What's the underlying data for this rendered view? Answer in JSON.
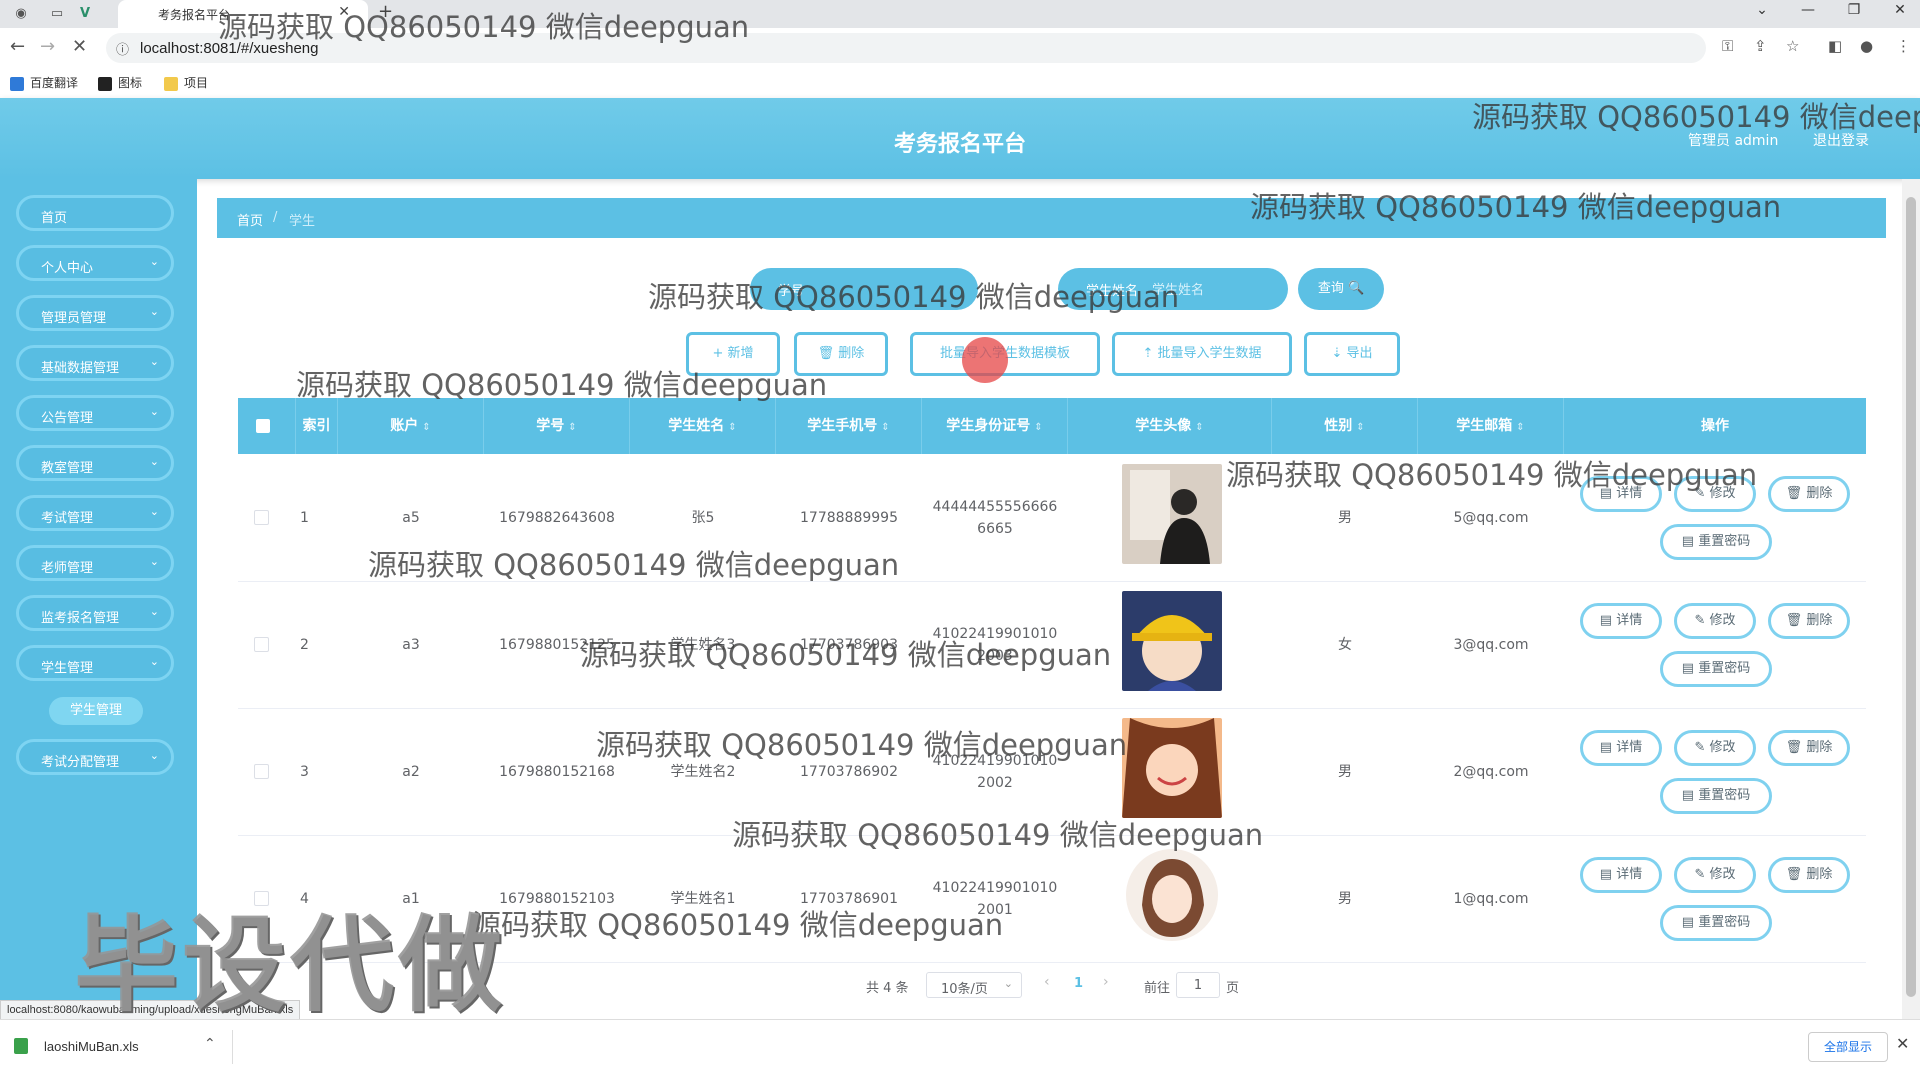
{
  "browser": {
    "tab_title": "考务报名平台",
    "url": "localhost:8081/#/xuesheng",
    "bookmarks": [
      "百度翻译",
      "图标",
      "项目"
    ]
  },
  "app": {
    "title": "考务报名平台",
    "user_label": "管理员 admin",
    "logout": "退出登录"
  },
  "sidebar": {
    "items": [
      "首页",
      "个人中心",
      "管理员管理",
      "基础数据管理",
      "公告管理",
      "教室管理",
      "考试管理",
      "老师管理",
      "监考报名管理",
      "学生管理",
      "考试分配管理"
    ],
    "active_sub": "学生管理"
  },
  "breadcrumb": {
    "home": "首页",
    "sep": "/",
    "current": "学生"
  },
  "search": {
    "field1_label": "学号",
    "field2_label": "学生姓名",
    "field2_placeholder": "学生姓名",
    "query_btn": "查询 🔍"
  },
  "toolbar": {
    "add": "+ 新增",
    "delete": "🗑 删除",
    "template": "批量导入学生数据模板",
    "import": "⇡ 批量导入学生数据",
    "export": "⇣ 导出"
  },
  "table": {
    "headers": [
      "索引",
      "账户",
      "学号",
      "学生姓名",
      "学生手机号",
      "学生身份证号",
      "学生头像",
      "性别",
      "学生邮箱",
      "操作"
    ],
    "rows": [
      {
        "index": "1",
        "account": "a5",
        "student_no": "1679882643608",
        "name": "张5",
        "phone": "17788889995",
        "id_card": "444444555566666665",
        "gender": "男",
        "email": "5@qq.com"
      },
      {
        "index": "2",
        "account": "a3",
        "student_no": "1679880152125",
        "name": "学生姓名3",
        "phone": "17703786903",
        "id_card": "410224199010102003",
        "gender": "女",
        "email": "3@qq.com"
      },
      {
        "index": "3",
        "account": "a2",
        "student_no": "1679880152168",
        "name": "学生姓名2",
        "phone": "17703786902",
        "id_card": "410224199010102002",
        "gender": "男",
        "email": "2@qq.com"
      },
      {
        "index": "4",
        "account": "a1",
        "student_no": "1679880152103",
        "name": "学生姓名1",
        "phone": "17703786901",
        "id_card": "410224199010102001",
        "gender": "男",
        "email": "1@qq.com"
      }
    ],
    "actions": {
      "detail": "详情",
      "edit": "修改",
      "remove": "删除",
      "reset_pwd": "重置密码"
    }
  },
  "pagination": {
    "total": "共 4 条",
    "page_size": "10条/页",
    "current_page": "1",
    "goto": "前往",
    "goto_value": "1",
    "page_unit": "页"
  },
  "status_url": "localhost:8080/kaowubaoming/upload/xueshengMuBan.xls",
  "download": {
    "file": "laoshiMuBan.xls",
    "show_all": "全部显示"
  },
  "watermarks": {
    "text": "源码获取 QQ86050149 微信deepguan",
    "text_cut": "源码获取 QQ86050149 微信deep",
    "big": "毕设代做"
  },
  "colors": {
    "primary": "#5cc0e4",
    "header_bg": "#70cbe9",
    "border_light": "#7fd1ef"
  }
}
